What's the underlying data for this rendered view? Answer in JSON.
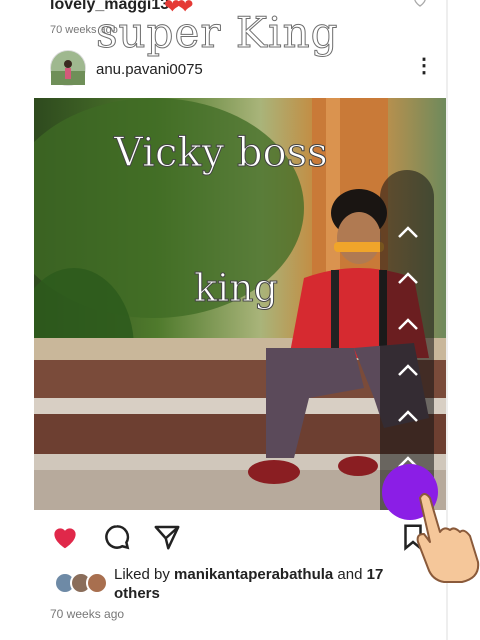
{
  "prev_post": {
    "username": "lovely_maggi13",
    "emoji": "❤❤",
    "time": "70 weeks ago",
    "overlay": "super King"
  },
  "post": {
    "username": "anu.pavani0075",
    "menu_icon": "⋮",
    "image_text_1": "Vicky boss",
    "image_text_2": "king",
    "likes_prefix": "Liked by ",
    "liked_by": "manikantaperabathula",
    "likes_and": " and ",
    "likes_count": "17 others",
    "time": "70 weeks ago"
  },
  "colors": {
    "like": "#e0284a",
    "accent_button": "#8b1ee6"
  },
  "icons": {
    "like": "heart-filled-icon",
    "comment": "comment-bubble-icon",
    "share": "send-paper-plane-icon",
    "save": "bookmark-icon",
    "scroll": "chevron-up-icon",
    "menu": "more-vertical-icon",
    "pointer": "pointing-hand-icon"
  }
}
